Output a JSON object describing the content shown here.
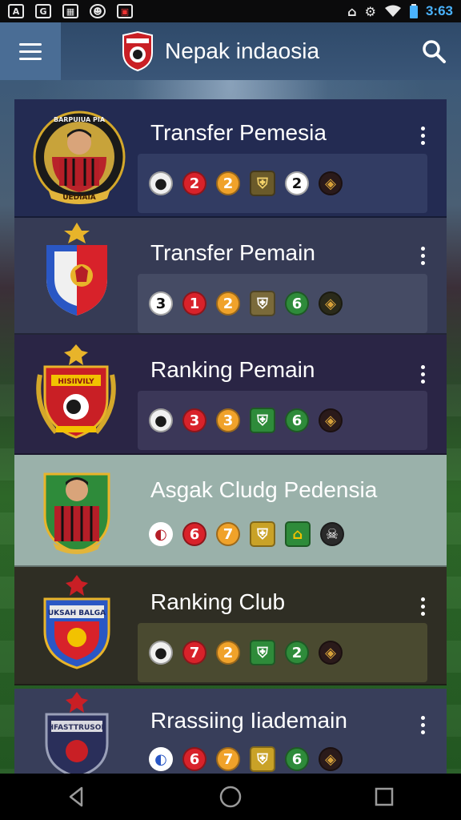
{
  "status_bar": {
    "left_icons": [
      {
        "icon": "a-icon",
        "text": "A"
      },
      {
        "icon": "chat-icon",
        "text": "G"
      },
      {
        "icon": "calendar-icon",
        "text": "▦"
      },
      {
        "icon": "face-icon",
        "text": "☻"
      },
      {
        "icon": "image-icon",
        "text": "▣"
      }
    ],
    "right_icons": [
      "home-icon",
      "settings-icon",
      "wifi-icon",
      "battery-icon"
    ],
    "time": "3:63"
  },
  "app_bar": {
    "menu_icon": "hamburger-icon",
    "logo_icon": "club-shield-logo",
    "title": "Nepak indaosia",
    "search_icon": "search-icon"
  },
  "colors": {
    "app_bar": "#3a5678",
    "red": "#d8222a",
    "orange": "#f0a22a",
    "gold": "#c9a227",
    "green": "#2e8b3a",
    "white": "#ffffff"
  },
  "cards": [
    {
      "title": "Transfer Pemesia",
      "crest_icon": "player-portrait-crest",
      "chips": [
        {
          "icon": "team-logo-icon",
          "label": ""
        },
        {
          "icon": "",
          "label": "2",
          "color": "red"
        },
        {
          "icon": "",
          "label": "2",
          "color": "orange"
        },
        {
          "icon": "badge-icon",
          "label": "",
          "color": "gold"
        },
        {
          "icon": "",
          "label": "2",
          "color": "white"
        },
        {
          "icon": "shield-icon",
          "label": "",
          "color": "dark"
        }
      ]
    },
    {
      "title": "Transfer Pemain",
      "crest_icon": "club-crest-red-blue",
      "chips": [
        {
          "icon": "",
          "label": "3",
          "color": "white"
        },
        {
          "icon": "",
          "label": "1",
          "color": "red"
        },
        {
          "icon": "",
          "label": "2",
          "color": "orange"
        },
        {
          "icon": "badge-icon",
          "label": "",
          "color": "gold"
        },
        {
          "icon": "",
          "label": "6",
          "color": "green"
        },
        {
          "icon": "shield-icon",
          "label": "",
          "color": "dark"
        }
      ]
    },
    {
      "title": "Ranking Pemain",
      "crest_icon": "club-crest-laurel",
      "chips": [
        {
          "icon": "team-logo-icon",
          "label": ""
        },
        {
          "icon": "",
          "label": "3",
          "color": "red"
        },
        {
          "icon": "",
          "label": "3",
          "color": "orange"
        },
        {
          "icon": "badge-icon",
          "label": "",
          "color": "green"
        },
        {
          "icon": "",
          "label": "6",
          "color": "green"
        },
        {
          "icon": "shield-icon",
          "label": "",
          "color": "dark"
        }
      ]
    },
    {
      "title": "Asgak Cludg  Pedensia",
      "crest_icon": "player-portrait-crest-green",
      "chips": [
        {
          "icon": "ball-icon",
          "label": ""
        },
        {
          "icon": "",
          "label": "6",
          "color": "red"
        },
        {
          "icon": "",
          "label": "7",
          "color": "orange"
        },
        {
          "icon": "badge-icon",
          "label": "",
          "color": "gold"
        },
        {
          "icon": "home-badge-icon",
          "label": "",
          "color": "green"
        },
        {
          "icon": "skull-icon",
          "label": "",
          "color": "dark"
        }
      ]
    },
    {
      "title": "Ranking Club",
      "crest_icon": "club-crest-blue",
      "chips": [
        {
          "icon": "team-logo-icon",
          "label": ""
        },
        {
          "icon": "",
          "label": "7",
          "color": "red"
        },
        {
          "icon": "",
          "label": "2",
          "color": "orange"
        },
        {
          "icon": "badge-icon",
          "label": "",
          "color": "green"
        },
        {
          "icon": "",
          "label": "2",
          "color": "green"
        },
        {
          "icon": "shield-icon",
          "label": "",
          "color": "dark"
        }
      ]
    },
    {
      "title": "Rrassiing Iiademain",
      "crest_icon": "club-crest-navy",
      "chips": [
        {
          "icon": "ball-icon",
          "label": ""
        },
        {
          "icon": "",
          "label": "6",
          "color": "red"
        },
        {
          "icon": "",
          "label": "7",
          "color": "orange"
        },
        {
          "icon": "badge-icon",
          "label": "",
          "color": "gold"
        },
        {
          "icon": "",
          "label": "6",
          "color": "green"
        },
        {
          "icon": "shield-icon",
          "label": "",
          "color": "dark"
        }
      ]
    }
  ],
  "crest_texts": {
    "card1_ring": "BARPUIUA PIA",
    "card1_ribbon": "UEDIAIA",
    "card3_top": "HISIIVILY",
    "card5_top": "UKSAH BALGA",
    "card6_top": "HFASTTRUSOE"
  },
  "nav_bar": {
    "back": "back-icon",
    "home": "home-icon",
    "recents": "recents-icon"
  }
}
